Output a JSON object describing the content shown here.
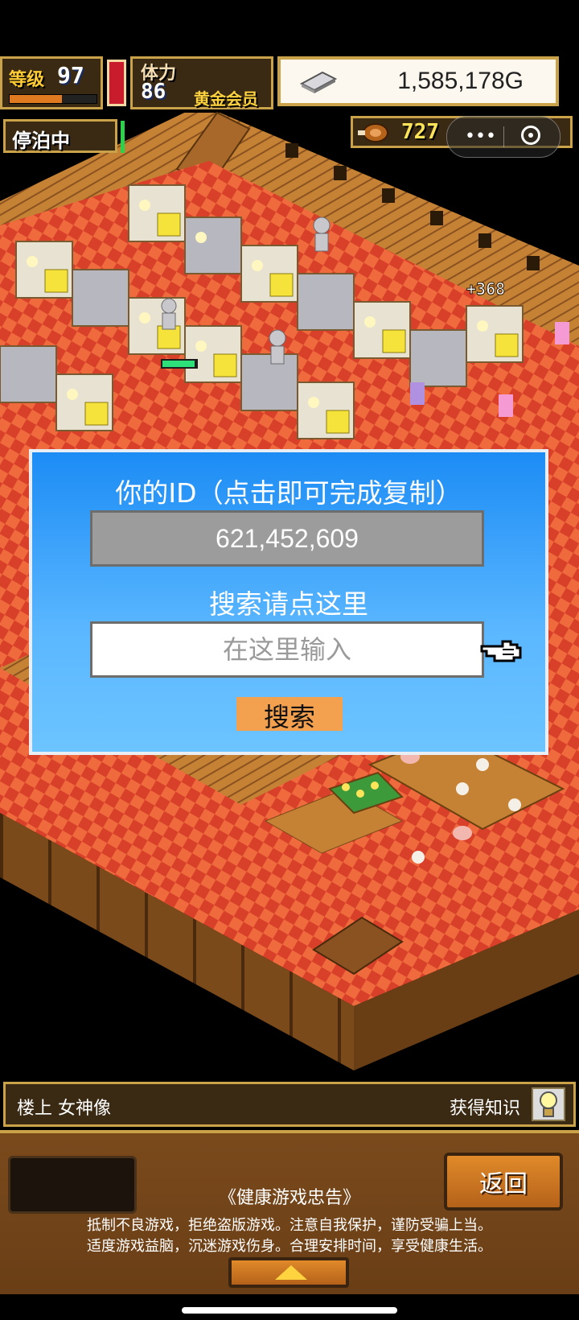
{
  "top_bar": {
    "level_label": "等级",
    "level_value": "97",
    "level_progress": 0.6,
    "stamina_label": "体力",
    "stamina_value": "86",
    "vip_label": "黄金会员",
    "gold": "1,585,178G",
    "anchor_status": "停泊中",
    "food_value": "727"
  },
  "scene": {
    "float_text": "+368"
  },
  "dialog": {
    "title": "你的ID（点击即可完成复制）",
    "id_value": "621,452,609",
    "search_title": "搜索请点这里",
    "search_placeholder": "在这里输入",
    "search_button": "搜索"
  },
  "info_bar": {
    "left_text": "楼上 女神像",
    "right_text": "获得知识"
  },
  "bottom": {
    "back_button": "返回",
    "notice_title": "《健康游戏忠告》",
    "notice_line1": "抵制不良游戏，拒绝盗版游戏。注意自我保护，谨防受骗上当。",
    "notice_line2": "适度游戏益脑，沉迷游戏伤身。合理安排时间，享受健康生活。"
  },
  "colors": {
    "floor_red": "#d8402a",
    "wood": "#b8752e",
    "dialog_blue": "#2a97f7",
    "button_orange": "#f3a04f"
  }
}
